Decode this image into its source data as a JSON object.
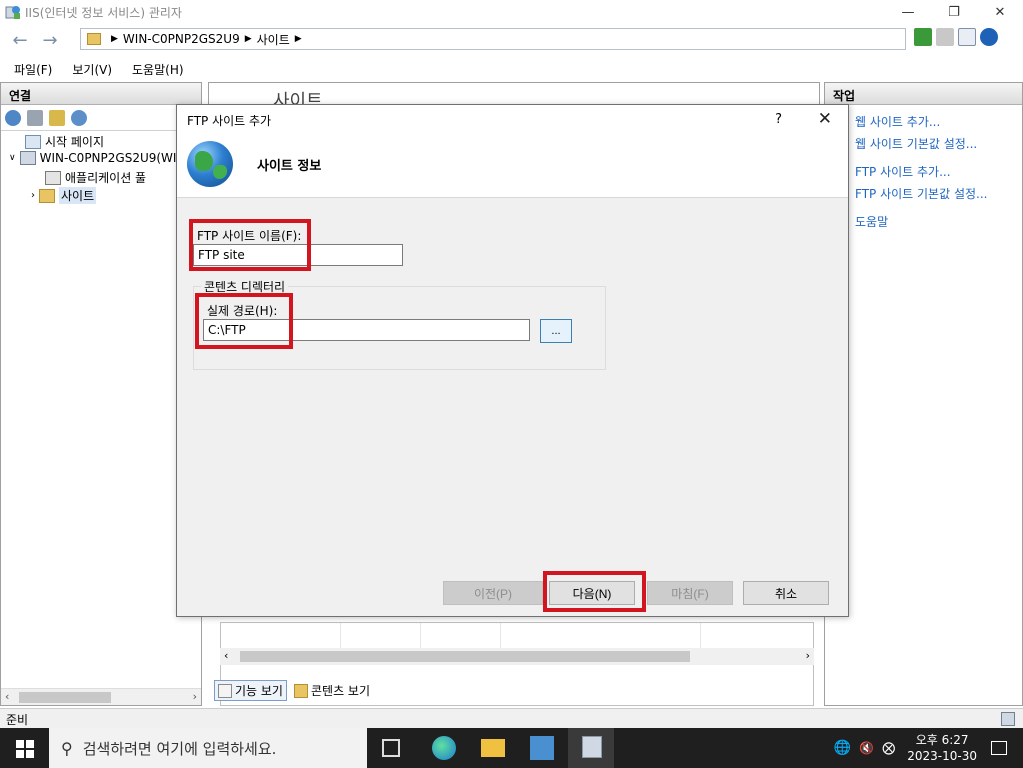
{
  "window": {
    "title": "IIS(인터넷 정보 서비스) 관리자",
    "controls": [
      "—",
      "❐",
      "✕"
    ]
  },
  "address": {
    "breadcrumb": [
      "WIN-C0PNP2GS2U9",
      "사이트"
    ]
  },
  "menu": [
    "파일(F)",
    "보기(V)",
    "도움말(H)"
  ],
  "left_panel": {
    "header": "연결",
    "tree": {
      "start_page": "시작 페이지",
      "server": "WIN-C0PNP2GS2U9(WI",
      "app_pools": "애플리케이션 풀",
      "sites": "사이트"
    }
  },
  "center_panel": {
    "header_fragment": "사이트",
    "view_tabs": [
      "기능 보기",
      "콘텐츠 보기"
    ]
  },
  "right_panel": {
    "header": "작업",
    "actions": [
      "웹 사이트 추가...",
      "웹 사이트 기본값 설정...",
      "FTP 사이트 추가...",
      "FTP 사이트 기본값 설정...",
      "도움말"
    ]
  },
  "status": "준비",
  "dialog": {
    "title": "FTP 사이트 추가",
    "help": "?",
    "close": "✕",
    "banner_title": "사이트 정보",
    "site_name_label": "FTP 사이트 이름(F):",
    "site_name_value": "FTP site",
    "group_label": "콘텐츠 디렉터리",
    "path_label": "실제 경로(H):",
    "path_value": "C:\\FTP",
    "browse": "...",
    "buttons": {
      "previous": "이전(P)",
      "next": "다음(N)",
      "finish": "마침(F)",
      "cancel": "취소"
    }
  },
  "taskbar": {
    "search_placeholder": "검색하려면 여기에 입력하세요.",
    "time": "오후 6:27",
    "date": "2023-10-30"
  },
  "colors": {
    "highlight": "#d2151e",
    "link": "#1f66c2"
  }
}
